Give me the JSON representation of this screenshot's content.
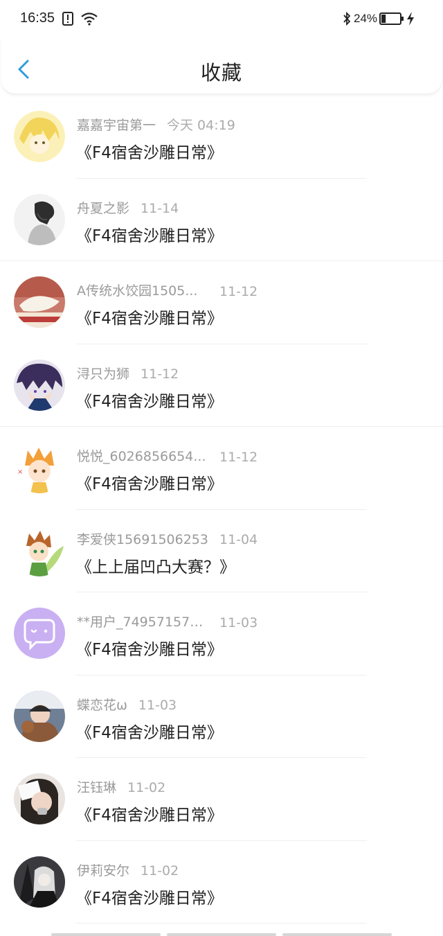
{
  "status_bar": {
    "time": "16:35",
    "battery_percent": "24%",
    "battery_level": 0.24
  },
  "header": {
    "title": "收藏"
  },
  "items": [
    {
      "name": "嘉嘉宇宙第一",
      "date": "今天 04:19",
      "subject": "《F4宿舍沙雕日常》",
      "avatar": "anime-blonde-avatar"
    },
    {
      "name": "舟夏之影",
      "date": "11-14",
      "subject": "《F4宿舍沙雕日常》",
      "avatar": "sketch-portrait-avatar"
    },
    {
      "name": "A传统水饺园1505...",
      "date": "11-12",
      "subject": "《F4宿舍沙雕日常》",
      "avatar": "dumpling-photo-avatar"
    },
    {
      "name": "浔只为狮",
      "date": "11-12",
      "subject": "《F4宿舍沙雕日常》",
      "avatar": "anime-purple-hair-avatar"
    },
    {
      "name": "悦悦_6026856654...",
      "date": "11-12",
      "subject": "《F4宿舍沙雕日常》",
      "avatar": "chibi-orange-hair-avatar"
    },
    {
      "name": "李爱侠15691506253",
      "date": "11-04",
      "subject": "《上上届凹凸大赛？》",
      "avatar": "chibi-green-avatar"
    },
    {
      "name": "**用户_749571570...",
      "date": "11-03",
      "subject": "《F4宿舍沙雕日常》",
      "avatar": "default-chat-bubble-avatar"
    },
    {
      "name": "蝶恋花ω",
      "date": "11-03",
      "subject": "《F4宿舍沙雕日常》",
      "avatar": "child-photo-avatar"
    },
    {
      "name": "汪钰琳",
      "date": "11-02",
      "subject": "《F4宿舍沙雕日常》",
      "avatar": "selfie-photo-avatar"
    },
    {
      "name": "伊莉安尔",
      "date": "11-02",
      "subject": "《F4宿舍沙雕日常》",
      "avatar": "dark-anime-avatar"
    }
  ],
  "colors": {
    "accent": "#2f9bdc",
    "name_text": "#9a9a9a",
    "subject_text": "#222222",
    "divider": "#eeeeee",
    "default_avatar": "#c9b0f2"
  },
  "icons": {
    "back": "chevron-left-icon",
    "alert": "alert-box-icon",
    "wifi": "wifi-icon",
    "bluetooth": "bluetooth-icon",
    "battery": "battery-icon",
    "charging": "lightning-icon"
  }
}
